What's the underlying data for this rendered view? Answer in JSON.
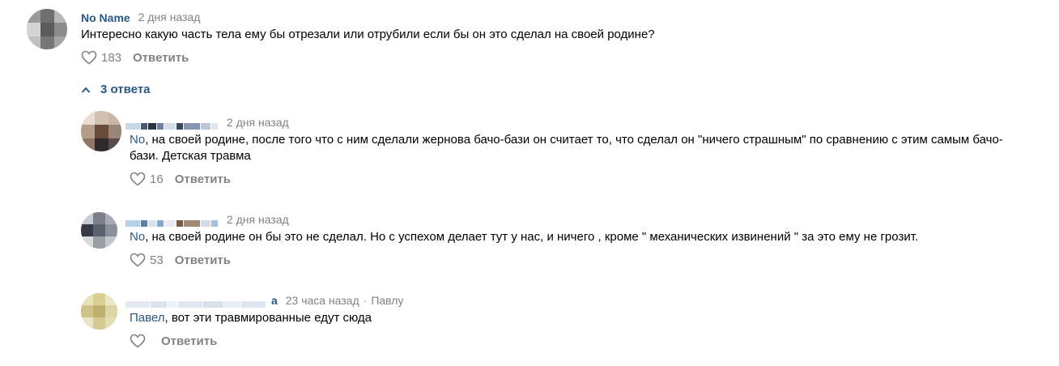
{
  "colors": {
    "link": "#2a5885",
    "muted": "#828282",
    "text": "#000000"
  },
  "main_comment": {
    "author": "No Name",
    "time": "2 дня назад",
    "text": "Интересно какую часть тела ему бы отрезали или отрубили если бы он это сделал на своей родине?",
    "likes": "183",
    "reply_label": "Ответить",
    "like_icon": "heart-outline-icon"
  },
  "replies_toggle": {
    "label": "3 ответа",
    "icon": "chevron-up-icon"
  },
  "replies": [
    {
      "time": "2 дня назад",
      "mention": "No",
      "text": ", на своей родине, после того что с ним сделали жернова бачо-бази он считает то, что сделал он \"ничего страшным\" по сравнению с этим самым бачо-бази. Детская травма",
      "likes": "16",
      "reply_label": "Ответить"
    },
    {
      "time": "2 дня назад",
      "mention": "No",
      "text": ", на своей родине он бы это не сделал. Но с успехом делает тут у нас, и ничего , кроме \" механических извинений \" за это ему не грозит.",
      "likes": "53",
      "reply_label": "Ответить"
    },
    {
      "author_tail": "а",
      "time": "23 часа назад",
      "reply_to": "Павлу",
      "mention": "Павел",
      "text": ", вот эти травмированные едут сюда",
      "likes": "",
      "reply_label": "Ответить"
    }
  ]
}
